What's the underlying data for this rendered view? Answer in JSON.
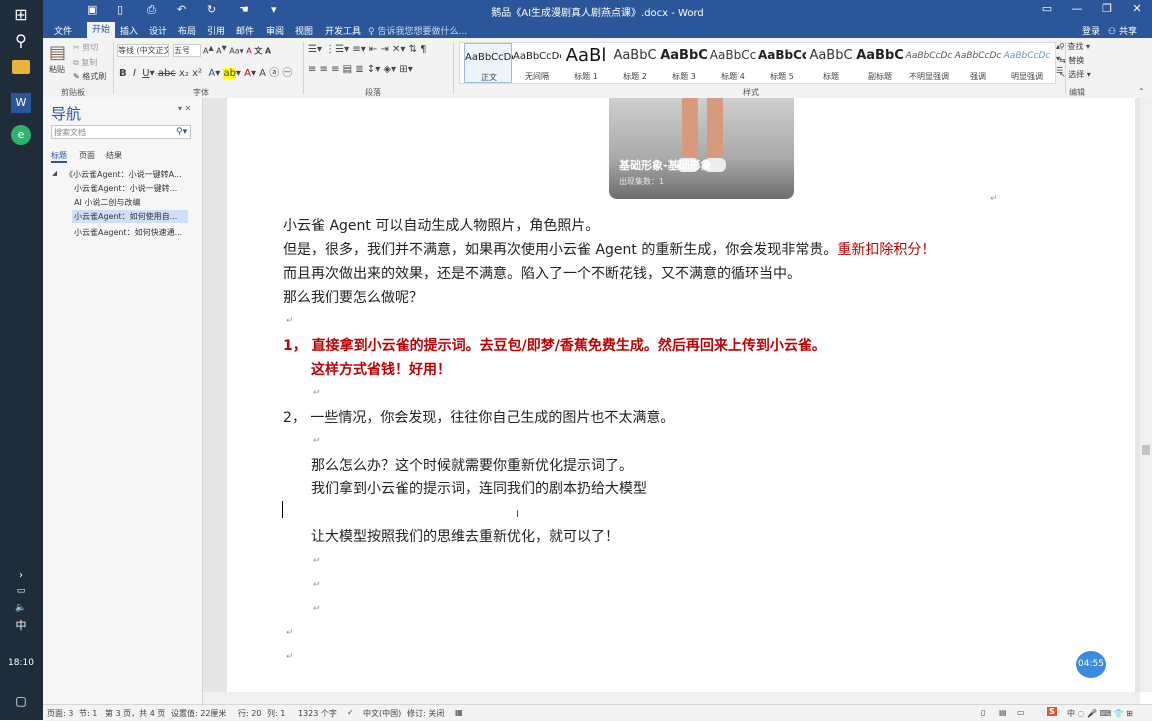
{
  "window": {
    "title": "鹅品《AI生成漫剧真人剧燕点课》.docx - Word"
  },
  "taskbar": {
    "clock": "18:10",
    "ime": "中"
  },
  "tabs": [
    "文件",
    "开始",
    "插入",
    "设计",
    "布局",
    "引用",
    "邮件",
    "审阅",
    "视图",
    "开发工具"
  ],
  "tell_me": "告诉我您想要做什么...",
  "account": {
    "login": "登录",
    "share": "共享"
  },
  "ribbon": {
    "clipboard": {
      "paste": "粘贴",
      "cut": "剪切",
      "copy": "复制",
      "format_painter": "格式刷",
      "label": "剪贴板"
    },
    "font": {
      "name": "等线 (中文正文)",
      "size": "五号",
      "label": "字体"
    },
    "paragraph": {
      "label": "段落"
    },
    "styles": {
      "label": "样式",
      "items": [
        {
          "preview": "AaBbCcDc",
          "name": "正文"
        },
        {
          "preview": "AaBbCcDc",
          "name": "无间隔"
        },
        {
          "preview": "AaBl",
          "name": "标题 1"
        },
        {
          "preview": "AaBbC",
          "name": "标题 2"
        },
        {
          "preview": "AaBbC",
          "name": "标题 3"
        },
        {
          "preview": "AaBbCc",
          "name": "标题 4"
        },
        {
          "preview": "AaBbCc",
          "name": "标题 5"
        },
        {
          "preview": "AaBbC",
          "name": "标题"
        },
        {
          "preview": "AaBbC",
          "name": "副标题"
        },
        {
          "preview": "AaBbCcDc",
          "name": "不明显强调"
        },
        {
          "preview": "AaBbCcDc",
          "name": "强调"
        },
        {
          "preview": "AaBbCcDc",
          "name": "明显强调"
        }
      ]
    },
    "editing": {
      "find": "查找",
      "replace": "替换",
      "select": "选择",
      "label": "编辑"
    }
  },
  "nav": {
    "title": "导航",
    "search_placeholder": "搜索文档",
    "tabs": [
      "标题",
      "页面",
      "结果"
    ],
    "items": [
      "《小云雀Agent：小说一键转A...",
      "小云雀Agent：小说一键转...",
      "AI 小说二创与改编",
      "小云雀Agent：如何使用自...",
      "小云雀Aagent：如何快速通..."
    ]
  },
  "card": {
    "title": "基础形象-基础形象",
    "subtitle": "出现集数：1"
  },
  "doc": {
    "p1": "小云雀 Agent 可以自动生成人物照片，角色照片。",
    "p2a": "但是，很多，我们并不满意，如果再次使用小云雀 Agent 的重新生成，你会发现非常贵。",
    "p2b": "重新扣除积分！",
    "p3": "而且再次做出来的效果，还是不满意。陷入了一个不断花钱，又不满意的循环当中。",
    "p4": "那么我们要怎么做呢？",
    "p5": "1，  直接拿到小云雀的提示词。去豆包/即梦/香蕉免费生成。然后再回来上传到小云雀。",
    "p6": "这样方式省钱！好用！",
    "p7": "2，  一些情况，你会发现，往往你自己生成的图片也不太满意。",
    "p8": "那么怎么办？这个时候就需要你重新优化提示词了。",
    "p9": "我们拿到小云雀的提示词，连同我们的剧本扔给大模型",
    "p10": "让大模型按照我们的思维去重新优化，就可以了！"
  },
  "status": {
    "page": "页面: 3",
    "section": "节: 1",
    "pages": "第 3 页，共 4 页",
    "position": "设置值: 22厘米",
    "line": "行: 20",
    "col": "列: 1",
    "words": "1323 个字",
    "lang": "中文(中国)",
    "track": "修订: 关闭"
  },
  "timer": "04:55",
  "colors": {
    "accent": "#2b579a",
    "red": "#c00000"
  }
}
